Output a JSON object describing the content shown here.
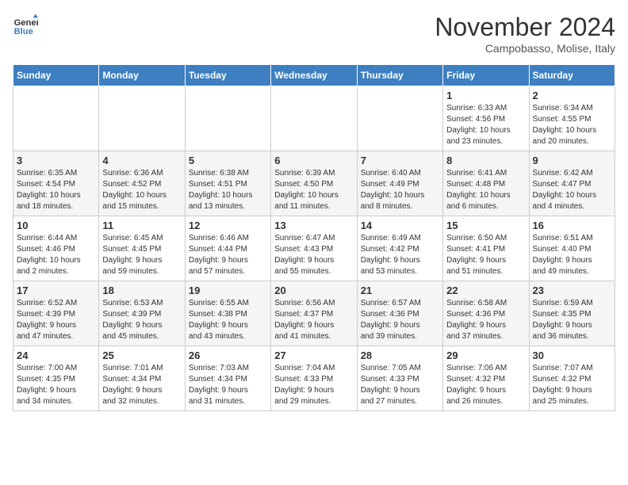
{
  "logo": {
    "line1": "General",
    "line2": "Blue"
  },
  "title": "November 2024",
  "location": "Campobasso, Molise, Italy",
  "weekdays": [
    "Sunday",
    "Monday",
    "Tuesday",
    "Wednesday",
    "Thursday",
    "Friday",
    "Saturday"
  ],
  "weeks": [
    [
      {
        "day": "",
        "info": ""
      },
      {
        "day": "",
        "info": ""
      },
      {
        "day": "",
        "info": ""
      },
      {
        "day": "",
        "info": ""
      },
      {
        "day": "",
        "info": ""
      },
      {
        "day": "1",
        "info": "Sunrise: 6:33 AM\nSunset: 4:56 PM\nDaylight: 10 hours\nand 23 minutes."
      },
      {
        "day": "2",
        "info": "Sunrise: 6:34 AM\nSunset: 4:55 PM\nDaylight: 10 hours\nand 20 minutes."
      }
    ],
    [
      {
        "day": "3",
        "info": "Sunrise: 6:35 AM\nSunset: 4:54 PM\nDaylight: 10 hours\nand 18 minutes."
      },
      {
        "day": "4",
        "info": "Sunrise: 6:36 AM\nSunset: 4:52 PM\nDaylight: 10 hours\nand 15 minutes."
      },
      {
        "day": "5",
        "info": "Sunrise: 6:38 AM\nSunset: 4:51 PM\nDaylight: 10 hours\nand 13 minutes."
      },
      {
        "day": "6",
        "info": "Sunrise: 6:39 AM\nSunset: 4:50 PM\nDaylight: 10 hours\nand 11 minutes."
      },
      {
        "day": "7",
        "info": "Sunrise: 6:40 AM\nSunset: 4:49 PM\nDaylight: 10 hours\nand 8 minutes."
      },
      {
        "day": "8",
        "info": "Sunrise: 6:41 AM\nSunset: 4:48 PM\nDaylight: 10 hours\nand 6 minutes."
      },
      {
        "day": "9",
        "info": "Sunrise: 6:42 AM\nSunset: 4:47 PM\nDaylight: 10 hours\nand 4 minutes."
      }
    ],
    [
      {
        "day": "10",
        "info": "Sunrise: 6:44 AM\nSunset: 4:46 PM\nDaylight: 10 hours\nand 2 minutes."
      },
      {
        "day": "11",
        "info": "Sunrise: 6:45 AM\nSunset: 4:45 PM\nDaylight: 9 hours\nand 59 minutes."
      },
      {
        "day": "12",
        "info": "Sunrise: 6:46 AM\nSunset: 4:44 PM\nDaylight: 9 hours\nand 57 minutes."
      },
      {
        "day": "13",
        "info": "Sunrise: 6:47 AM\nSunset: 4:43 PM\nDaylight: 9 hours\nand 55 minutes."
      },
      {
        "day": "14",
        "info": "Sunrise: 6:49 AM\nSunset: 4:42 PM\nDaylight: 9 hours\nand 53 minutes."
      },
      {
        "day": "15",
        "info": "Sunrise: 6:50 AM\nSunset: 4:41 PM\nDaylight: 9 hours\nand 51 minutes."
      },
      {
        "day": "16",
        "info": "Sunrise: 6:51 AM\nSunset: 4:40 PM\nDaylight: 9 hours\nand 49 minutes."
      }
    ],
    [
      {
        "day": "17",
        "info": "Sunrise: 6:52 AM\nSunset: 4:39 PM\nDaylight: 9 hours\nand 47 minutes."
      },
      {
        "day": "18",
        "info": "Sunrise: 6:53 AM\nSunset: 4:39 PM\nDaylight: 9 hours\nand 45 minutes."
      },
      {
        "day": "19",
        "info": "Sunrise: 6:55 AM\nSunset: 4:38 PM\nDaylight: 9 hours\nand 43 minutes."
      },
      {
        "day": "20",
        "info": "Sunrise: 6:56 AM\nSunset: 4:37 PM\nDaylight: 9 hours\nand 41 minutes."
      },
      {
        "day": "21",
        "info": "Sunrise: 6:57 AM\nSunset: 4:36 PM\nDaylight: 9 hours\nand 39 minutes."
      },
      {
        "day": "22",
        "info": "Sunrise: 6:58 AM\nSunset: 4:36 PM\nDaylight: 9 hours\nand 37 minutes."
      },
      {
        "day": "23",
        "info": "Sunrise: 6:59 AM\nSunset: 4:35 PM\nDaylight: 9 hours\nand 36 minutes."
      }
    ],
    [
      {
        "day": "24",
        "info": "Sunrise: 7:00 AM\nSunset: 4:35 PM\nDaylight: 9 hours\nand 34 minutes."
      },
      {
        "day": "25",
        "info": "Sunrise: 7:01 AM\nSunset: 4:34 PM\nDaylight: 9 hours\nand 32 minutes."
      },
      {
        "day": "26",
        "info": "Sunrise: 7:03 AM\nSunset: 4:34 PM\nDaylight: 9 hours\nand 31 minutes."
      },
      {
        "day": "27",
        "info": "Sunrise: 7:04 AM\nSunset: 4:33 PM\nDaylight: 9 hours\nand 29 minutes."
      },
      {
        "day": "28",
        "info": "Sunrise: 7:05 AM\nSunset: 4:33 PM\nDaylight: 9 hours\nand 27 minutes."
      },
      {
        "day": "29",
        "info": "Sunrise: 7:06 AM\nSunset: 4:32 PM\nDaylight: 9 hours\nand 26 minutes."
      },
      {
        "day": "30",
        "info": "Sunrise: 7:07 AM\nSunset: 4:32 PM\nDaylight: 9 hours\nand 25 minutes."
      }
    ]
  ]
}
